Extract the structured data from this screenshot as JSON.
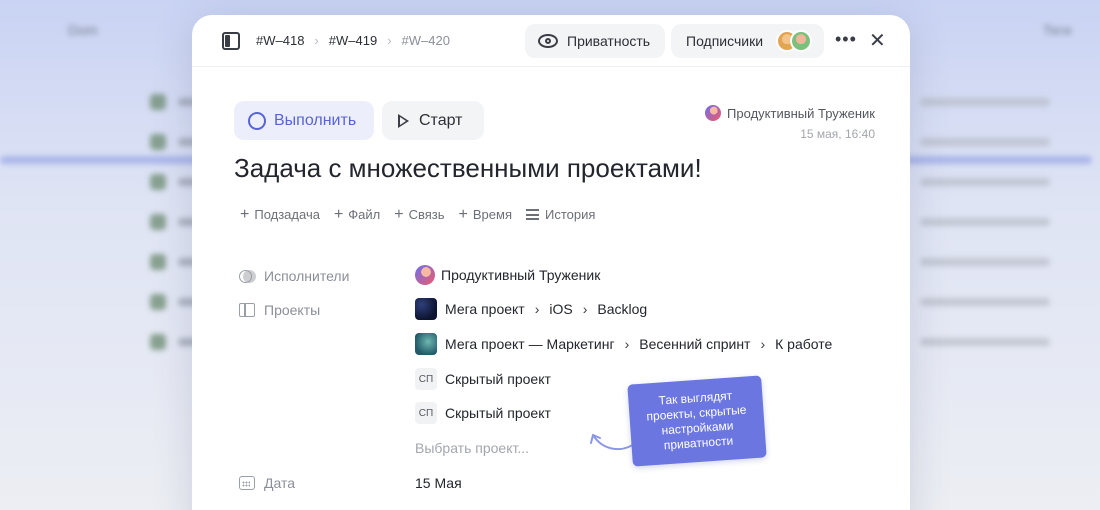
{
  "background": {
    "col_left": "Dom",
    "col_right": "Теги"
  },
  "topbar": {
    "crumbs": [
      "#W–418",
      "#W–419",
      "#W–420"
    ],
    "privacy_label": "Приватность",
    "subscribers_label": "Подписчики"
  },
  "toolbar": {
    "done_label": "Выполнить",
    "start_label": "Старт"
  },
  "author": {
    "name": "Продуктивный Труженик",
    "date": "15 мая, 16:40"
  },
  "task": {
    "title": "Задача с множественными проектами!"
  },
  "actions": {
    "subtask": "Подзадача",
    "file": "Файл",
    "link": "Связь",
    "time": "Время",
    "history": "История"
  },
  "props": {
    "assignees_label": "Исполнители",
    "assignee_name": "Продуктивный Труженик",
    "projects_label": "Проекты",
    "project1": [
      "Мега проект",
      "iOS",
      "Backlog"
    ],
    "project2": [
      "Мега проект — Маркетинг",
      "Весенний спринт",
      "К работе"
    ],
    "hidden_abbr": "СП",
    "hidden_project": "Скрытый проект",
    "choose_project": "Выбрать проект...",
    "date_label": "Дата",
    "date_value": "15 Мая"
  },
  "tooltip": {
    "lines": [
      "Так выглядят",
      "проекты, скрытые",
      "настройками",
      "приватности"
    ]
  }
}
